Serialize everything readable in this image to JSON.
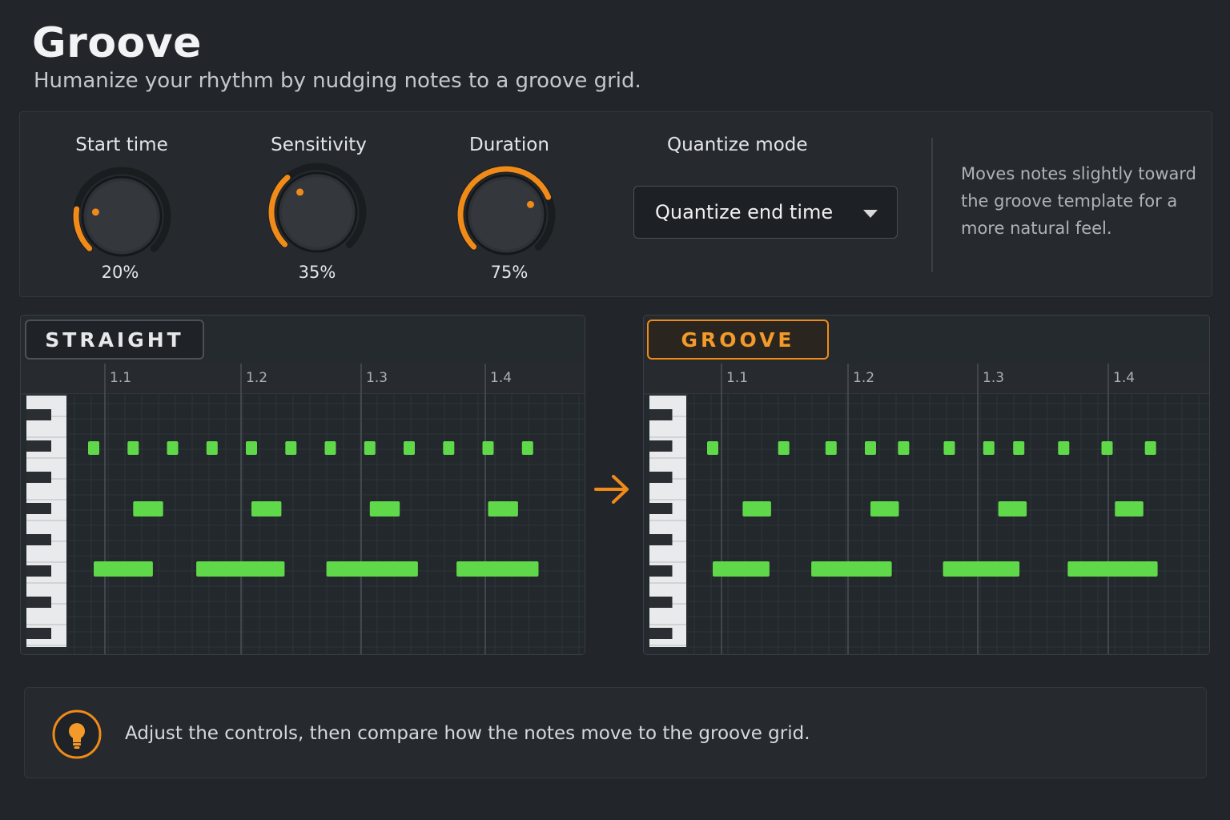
{
  "header": {
    "title": "Groove",
    "subtitle": "Humanize your rhythm by nudging notes to a groove grid."
  },
  "controls": {
    "knobs": [
      {
        "id": "start-time",
        "label": "Start time",
        "value_text": "20%",
        "value": 0.2
      },
      {
        "id": "sensitivity",
        "label": "Sensitivity",
        "value_text": "35%",
        "value": 0.35
      },
      {
        "id": "duration",
        "label": "Duration",
        "value_text": "75%",
        "value": 0.75
      }
    ],
    "quantize_mode": {
      "label": "Quantize mode",
      "selected": "Quantize end time",
      "caret_icon": "chevron-down-icon"
    },
    "info": "Moves notes slightly toward the groove template for a more natural feel."
  },
  "panels": {
    "straight": {
      "tag": "STRAIGHT",
      "bars": [
        "1.1",
        "1.2",
        "1.3",
        "1.4"
      ],
      "notes": {
        "hihat": [
          0.0,
          0.5,
          1.0,
          1.5,
          2.0,
          2.5,
          3.0,
          3.5,
          4.0,
          4.5,
          5.0,
          5.5
        ],
        "snare": [
          {
            "start": 0.5,
            "len": 0.38
          },
          {
            "start": 2.0,
            "len": 0.38
          },
          {
            "start": 3.5,
            "len": 0.38
          },
          {
            "start": 5.0,
            "len": 0.38
          }
        ],
        "bass": [
          {
            "start": 0.0,
            "len": 0.75
          },
          {
            "start": 1.3,
            "len": 1.12
          },
          {
            "start": 2.95,
            "len": 1.16
          },
          {
            "start": 4.6,
            "len": 1.04
          }
        ]
      }
    },
    "groove": {
      "tag": "GROOVE",
      "bars": [
        "1.1",
        "1.2",
        "1.3",
        "1.4"
      ],
      "notes": {
        "hihat": [
          0.0,
          0.9,
          1.5,
          2.0,
          2.42,
          3.0,
          3.5,
          3.88,
          4.45,
          5.0,
          5.55
        ],
        "snare": [
          {
            "start": 0.38,
            "len": 0.36
          },
          {
            "start": 2.0,
            "len": 0.36
          },
          {
            "start": 3.62,
            "len": 0.36
          },
          {
            "start": 5.1,
            "len": 0.36
          }
        ],
        "bass": [
          {
            "start": 0.0,
            "len": 0.72
          },
          {
            "start": 1.25,
            "len": 1.02
          },
          {
            "start": 2.92,
            "len": 0.97
          },
          {
            "start": 4.5,
            "len": 1.14
          }
        ]
      }
    },
    "arrow_icon": "arrow-right-icon"
  },
  "hint": {
    "icon": "lightbulb-icon",
    "text": "Adjust the controls, then compare how the notes move to the groove grid."
  },
  "colors": {
    "accent": "#f08a18",
    "note": "#5fd84a",
    "background": "#22262b"
  }
}
